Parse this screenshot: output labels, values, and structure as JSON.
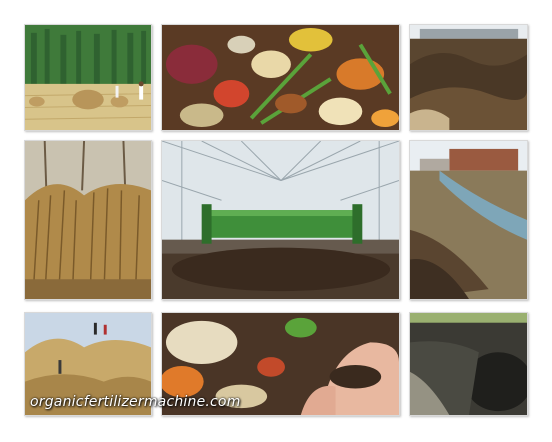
{
  "watermark": {
    "text": "organicfertilizermachine.com"
  },
  "panels": [
    {
      "id": "wheat-field",
      "subject": "harvested wheat field with straw bundles"
    },
    {
      "id": "food-scraps",
      "subject": "kitchen food scraps and vegetable peels"
    },
    {
      "id": "manure-pile",
      "subject": "heaps of livestock manure"
    },
    {
      "id": "corn-stalks",
      "subject": "stacked dry corn stalks"
    },
    {
      "id": "greenhouse",
      "subject": "green compost turner machine in greenhouse"
    },
    {
      "id": "ditch",
      "subject": "muddy ditch with sludge banks"
    },
    {
      "id": "straw-stacks",
      "subject": "workers on straw stacks"
    },
    {
      "id": "compost-hands",
      "subject": "hands holding finished compost among peels"
    },
    {
      "id": "dark-pile",
      "subject": "dark compost pile on field"
    }
  ],
  "colors": {
    "machine_green": "#3f8f3a",
    "soil_dark": "#3b2a1c",
    "straw": "#c8a96a"
  }
}
